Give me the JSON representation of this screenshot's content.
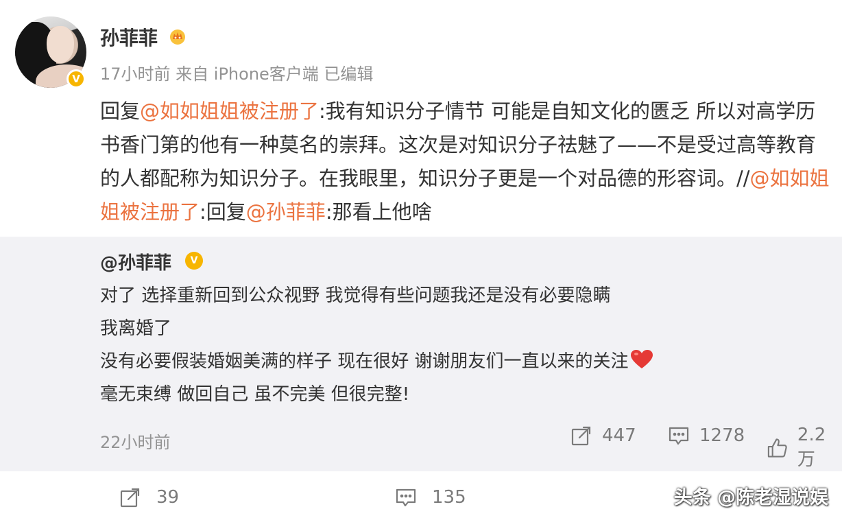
{
  "post": {
    "username": "孙菲菲",
    "meta": "17小时前 来自 iPhone客户端 已编辑",
    "content": {
      "reply_prefix": "回复",
      "mention1": "@如如姐姐被注册了",
      "text1": ":我有知识分子情节  可能是自知文化的匮乏 所以对高学历书香门第的他有一种莫名的崇拜。这次是对知识分子祛魅了——不是受过高等教育的人都配称为知识分子。在我眼里，知识分子更是一个对品德的形容词。//",
      "mention2": "@如如姐姐被注册了",
      "text2": ":回复",
      "mention3": "@孙菲菲",
      "text3": ":那看上他啥"
    }
  },
  "repost": {
    "user": "@孙菲菲",
    "lines": [
      "对了 选择重新回到公众视野 我觉得有些问题我还是没有必要隐瞒",
      "我离婚了",
      "没有必要假装婚姻美满的样子 现在很好 谢谢朋友们一直以来的关注",
      "毫无束缚 做回自己 虽不完美 但很完整!"
    ],
    "time": "22小时前",
    "share_count": "447",
    "comment_count": "1278",
    "like_count": "2.2万"
  },
  "footer": {
    "share_count": "39",
    "comment_count": "135"
  },
  "watermark": "头条 @陈老湿说娱",
  "colors": {
    "mention": "#eb7340",
    "meta": "#939393",
    "repost_bg": "#f2f2f5",
    "badge": "#f7b500",
    "heart": "#e53935"
  },
  "icons": [
    "crown-icon",
    "verified-badge-icon",
    "share-icon",
    "comment-icon",
    "like-icon",
    "heart-icon"
  ]
}
